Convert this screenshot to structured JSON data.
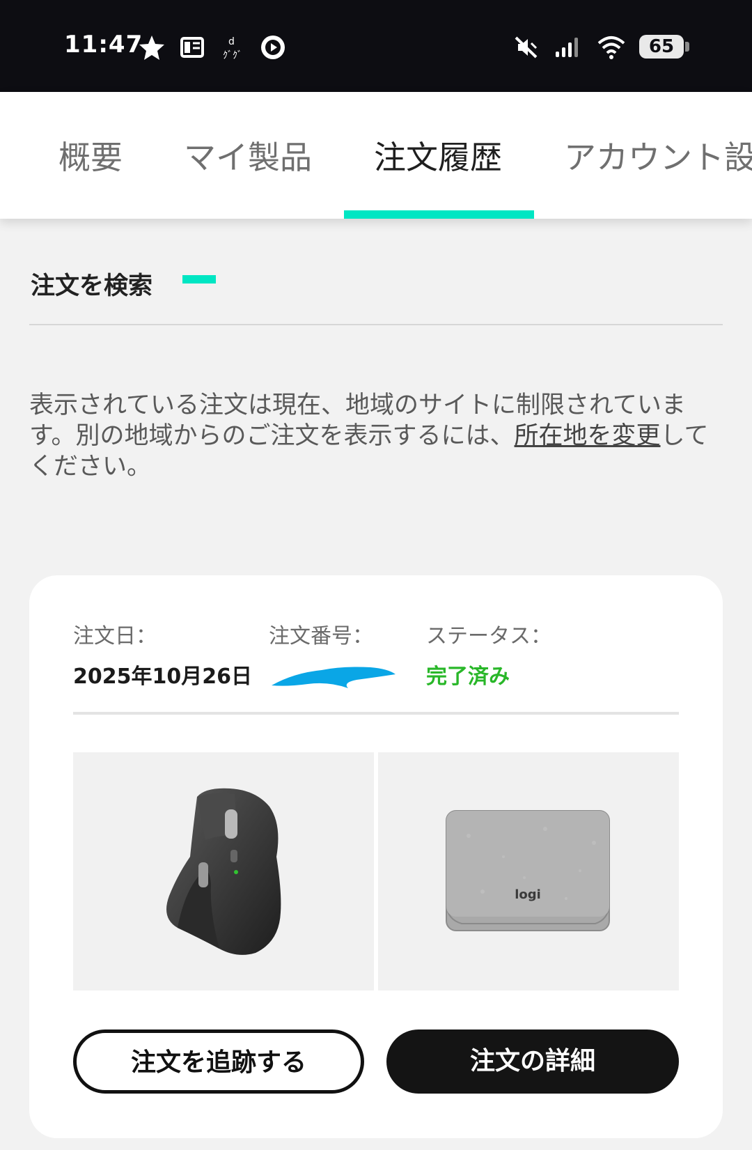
{
  "status_bar": {
    "time": "11:47",
    "battery": "65",
    "icons": [
      "star-icon",
      "reader-icon",
      "d-app-icon",
      "play-icon",
      "mute-icon",
      "signal-icon",
      "wifi-icon",
      "battery-icon"
    ]
  },
  "tabs": [
    {
      "label": "概要"
    },
    {
      "label": "マイ製品"
    },
    {
      "label": "注文履歴",
      "active": true
    },
    {
      "label": "アカウント設定"
    }
  ],
  "search": {
    "title": "注文を検索"
  },
  "notice": {
    "text_before": "表示されている注文は現在、地域のサイトに制限されています。別の地域からのご注文を表示するには、",
    "link": "所在地を変更",
    "text_after": "してください。"
  },
  "order": {
    "date_label": "注文日：",
    "date_value": "2025年10月26日",
    "number_label": "注文番号：",
    "status_label": "ステータス：",
    "status_value": "完了済み",
    "track_button": "注文を追跡する",
    "details_button": "注文の詳細",
    "item_logo": "logi"
  },
  "colors": {
    "accent": "#00e6c3",
    "status_complete": "#29b729",
    "redaction": "#0aa6e6"
  }
}
